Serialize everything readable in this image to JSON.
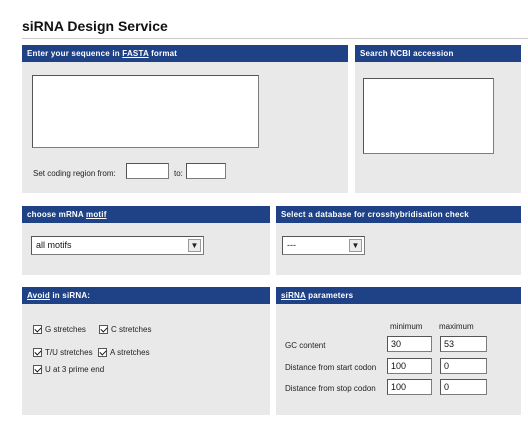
{
  "page": {
    "title": "siRNA Design Service"
  },
  "fasta": {
    "header_prefix": "Enter your sequence in ",
    "header_link": "FASTA",
    "header_suffix": " format",
    "coding_label": "Set coding region from:",
    "to_label": "to:",
    "from_value": "",
    "to_value": ""
  },
  "ncbi": {
    "header": "Search NCBI accession"
  },
  "motif": {
    "header_prefix": "choose mRNA ",
    "header_link": "motif",
    "selected": "all motifs"
  },
  "database": {
    "header": "Select a database for crosshybridisation check",
    "selected": "---"
  },
  "avoid": {
    "header_link": "Avoid",
    "header_suffix": " in siRNA:",
    "options": [
      "G stretches",
      "C stretches",
      "T/U stretches",
      "A stretches",
      "U at 3 prime end"
    ]
  },
  "params": {
    "header_link": "siRNA",
    "header_suffix": " parameters",
    "col_min": "minimum",
    "col_max": "maximum",
    "rows": [
      {
        "label": "GC content",
        "min": "30",
        "max": "53"
      },
      {
        "label": "Distance from start codon",
        "min": "100",
        "max": "0"
      },
      {
        "label": "Distance from stop codon",
        "min": "100",
        "max": "0"
      }
    ]
  }
}
